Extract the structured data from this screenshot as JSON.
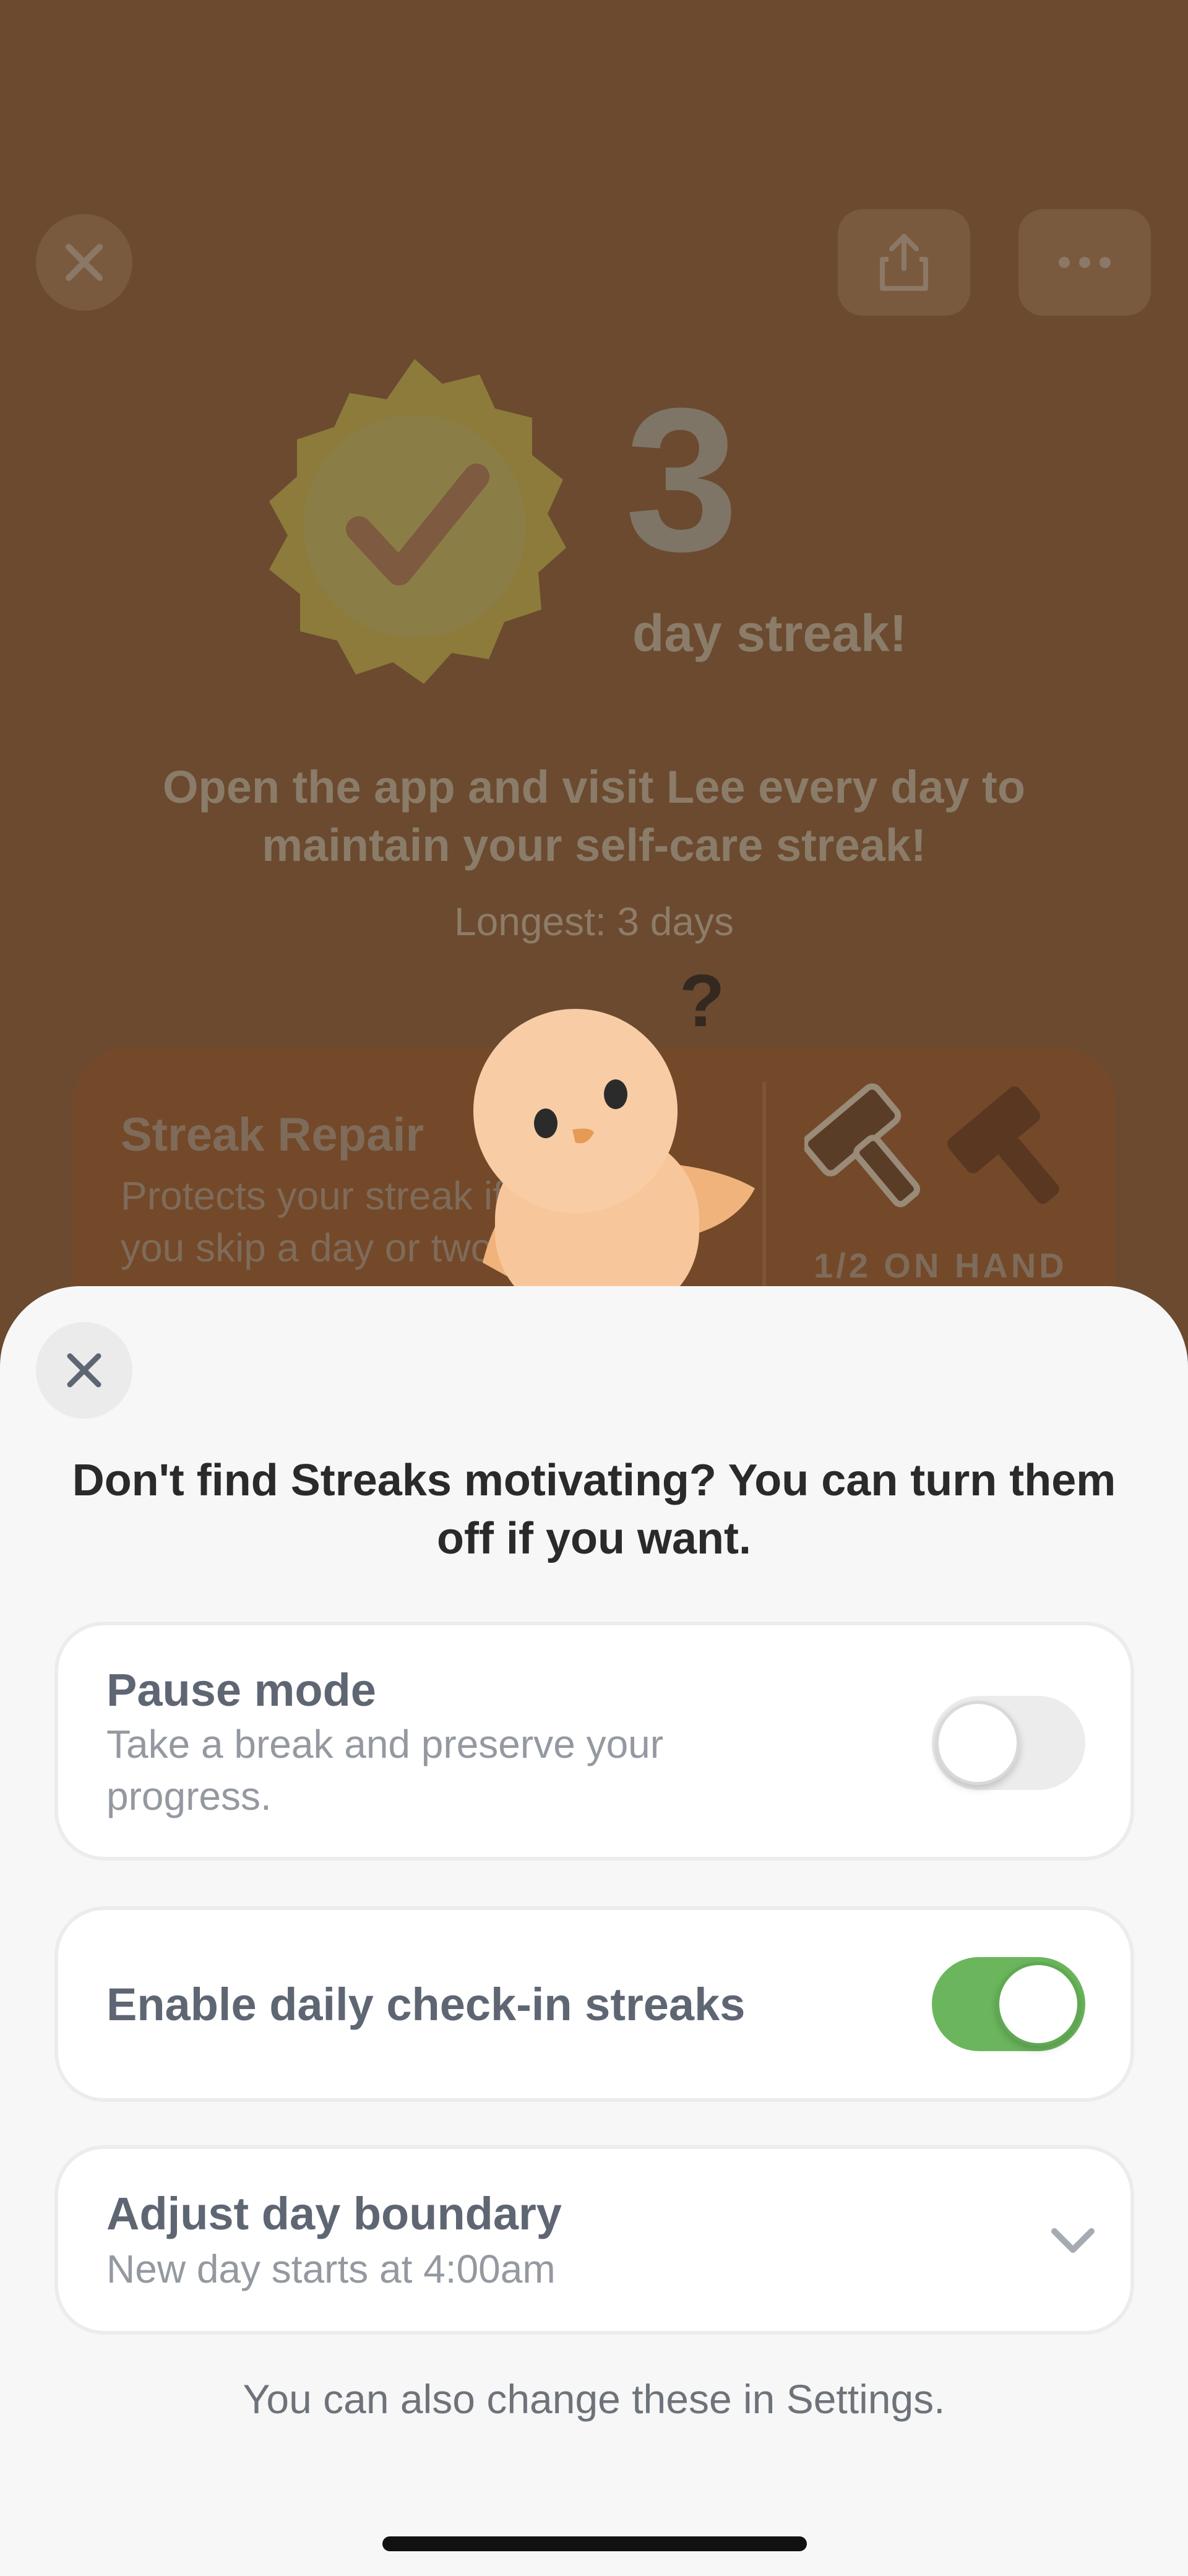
{
  "background": {
    "streak_count": "3",
    "streak_label": "day streak!",
    "motivation_text": "Open the app and visit Lee every day to maintain your self-care streak!",
    "longest_text": "Longest: 3 days",
    "streak_repair": {
      "title": "Streak Repair",
      "description": "Protects your streak if you skip a day or two.",
      "on_hand": "1/2 ON HAND"
    },
    "question_mark": "?",
    "icons": [
      "close-icon",
      "share-icon",
      "more-icon",
      "checkmark-badge-icon",
      "hammer-icon"
    ]
  },
  "sheet": {
    "heading": "Don't find Streaks motivating? You can turn them off if you want.",
    "pause_mode": {
      "title": "Pause mode",
      "subtitle": "Take a break and preserve your progress.",
      "enabled": false
    },
    "daily_streaks": {
      "title": "Enable daily check-in streaks",
      "enabled": true
    },
    "day_boundary": {
      "title": "Adjust day boundary",
      "subtitle": "New day starts at 4:00am"
    },
    "footer_note": "You can also change these in Settings."
  },
  "colors": {
    "background": "#6b4a30",
    "sheet": "#f7f7f7",
    "toggle_on": "#6bb65c",
    "toggle_off": "#ececec",
    "text_dark": "#2a2a2a",
    "text_muted": "#9499a1"
  }
}
